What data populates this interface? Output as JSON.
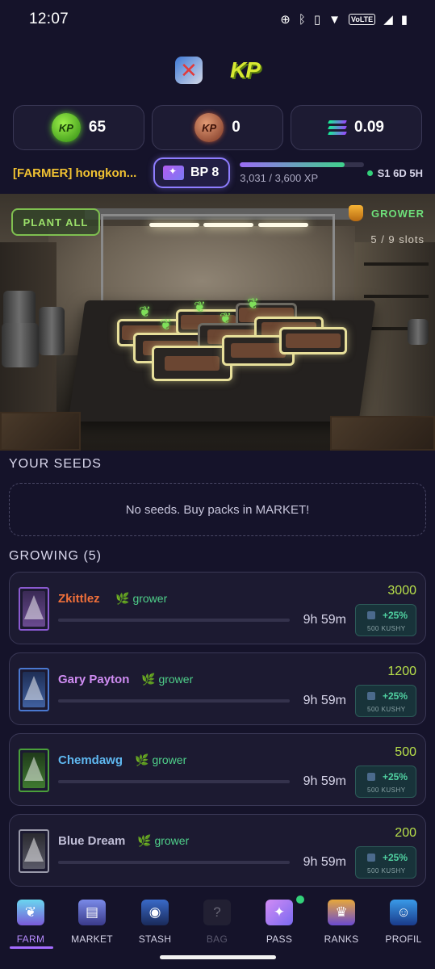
{
  "status_bar": {
    "time": "12:07",
    "icons": [
      "sync-icon",
      "bluetooth-icon",
      "vibrate-icon",
      "wifi-icon",
      "volte-badge",
      "signal-icon",
      "battery-icon"
    ],
    "volte_label": "VoLTE"
  },
  "header": {
    "logo_text": "KP"
  },
  "currencies": [
    {
      "icon": "kp-coin-icon",
      "value": "65"
    },
    {
      "icon": "copper-coin-icon",
      "value": "0"
    },
    {
      "icon": "solana-icon",
      "value": "0.09"
    }
  ],
  "player": {
    "name": "[FARMER] hongkon...",
    "battle_pass_label": "BP 8",
    "xp_text": "3,031 / 3,600 XP",
    "xp_progress": 0.842,
    "season_text": "S1 6D 5H"
  },
  "farm_scene": {
    "plant_all_label": "PLANT ALL",
    "rank_label": "GROWER",
    "slots_text": "5 / 9 slots"
  },
  "seeds": {
    "title": "YOUR SEEDS",
    "empty_text": "No seeds. Buy packs in MARKET!"
  },
  "growing": {
    "title": "GROWING (5)",
    "items": [
      {
        "name": "Zkittlez",
        "name_color": "#f0703a",
        "tag": "grower",
        "time": "9h 59m",
        "score": "3000",
        "boost": "+25%",
        "boost_sub": "500 KUSHY",
        "card_color": "#8a5ad0"
      },
      {
        "name": "Gary Payton",
        "name_color": "#cf8cf2",
        "tag": "grower",
        "time": "9h 59m",
        "score": "1200",
        "boost": "+25%",
        "boost_sub": "500 KUSHY",
        "card_color": "#4a78d0"
      },
      {
        "name": "Chemdawg",
        "name_color": "#5fb8f0",
        "tag": "grower",
        "time": "9h 59m",
        "score": "500",
        "boost": "+25%",
        "boost_sub": "500 KUSHY",
        "card_color": "#4aa03a"
      },
      {
        "name": "Blue Dream",
        "name_color": "#c0bed6",
        "tag": "grower",
        "time": "9h 59m",
        "score": "200",
        "boost": "+25%",
        "boost_sub": "500 KUSHY",
        "card_color": "#9a9aaa"
      }
    ]
  },
  "nav": {
    "items": [
      {
        "label": "FARM",
        "icon": "farm-icon",
        "state": "active"
      },
      {
        "label": "MARKET",
        "icon": "market-icon",
        "state": "normal"
      },
      {
        "label": "STASH",
        "icon": "stash-icon",
        "state": "normal"
      },
      {
        "label": "BAG",
        "icon": "bag-icon",
        "state": "disabled"
      },
      {
        "label": "PASS",
        "icon": "pass-icon",
        "state": "normal"
      },
      {
        "label": "RANKS",
        "icon": "ranks-icon",
        "state": "normal"
      },
      {
        "label": "PROFIL",
        "icon": "profile-icon",
        "state": "normal"
      }
    ]
  }
}
